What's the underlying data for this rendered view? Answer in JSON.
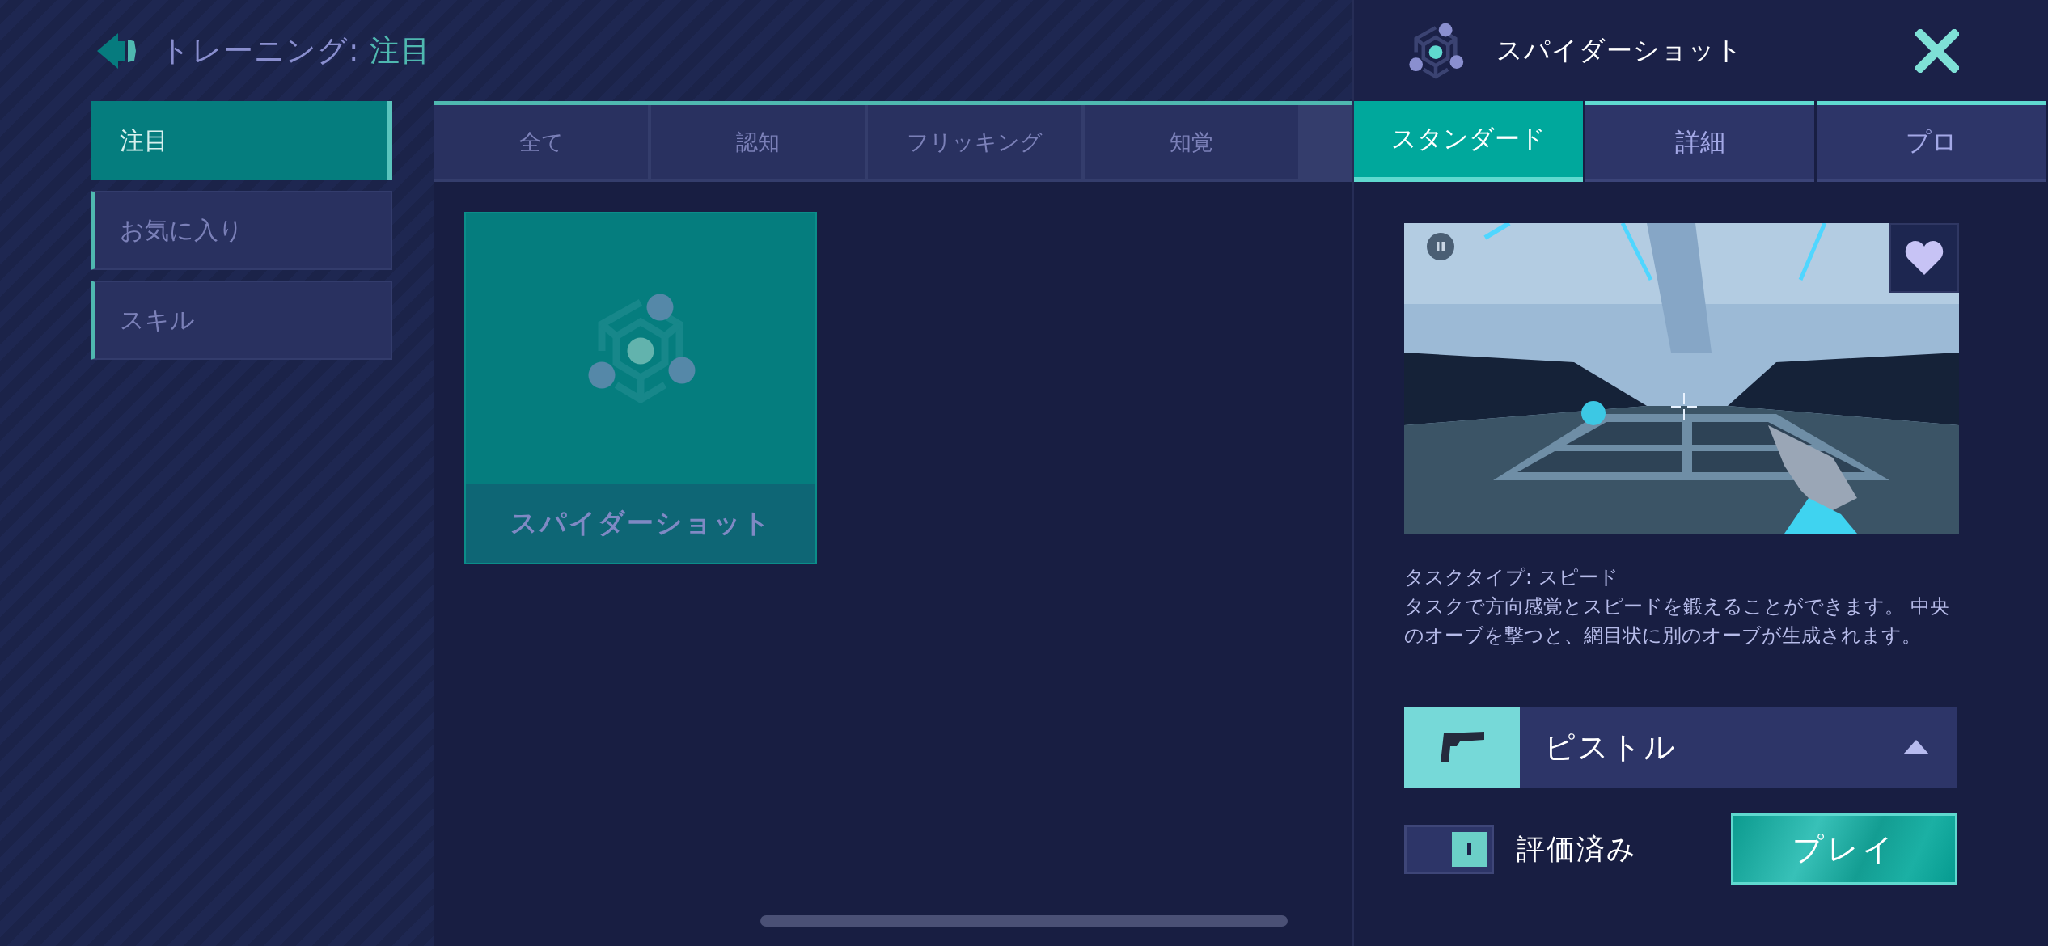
{
  "header": {
    "title_prefix": "トレーニング:",
    "title_category": "注目"
  },
  "sidebar": {
    "items": [
      {
        "label": "注目",
        "selected": true
      },
      {
        "label": "お気に入り",
        "selected": false
      },
      {
        "label": "スキル",
        "selected": false
      }
    ]
  },
  "category_tabs": [
    {
      "label": "全て",
      "selected": false
    },
    {
      "label": "認知",
      "selected": false
    },
    {
      "label": "フリッキング",
      "selected": false
    },
    {
      "label": "知覚",
      "selected": false
    }
  ],
  "tasks": [
    {
      "name": "スパイダーショット",
      "selected": true
    }
  ],
  "detail": {
    "title": "スパイダーショット",
    "difficulty_tabs": [
      {
        "label": "スタンダード",
        "selected": true
      },
      {
        "label": "詳細",
        "selected": false
      },
      {
        "label": "プロ",
        "selected": false
      }
    ],
    "task_type": "タスクタイプ: スピード",
    "description": "タスクで方向感覚とスピードを鍛えることができます。 中央のオーブを撃つと、網目状に別のオーブが生成されます。",
    "weapon": {
      "name": "ピストル"
    },
    "rated": {
      "label": "評価済み",
      "on": true
    },
    "play_button": "プレイ"
  }
}
